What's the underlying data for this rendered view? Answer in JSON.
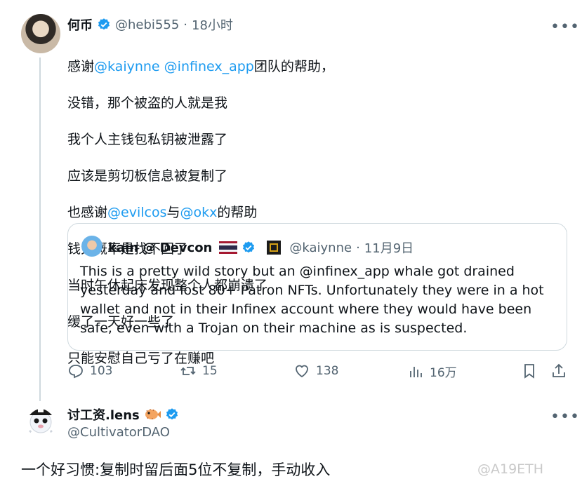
{
  "tweet": {
    "author_name": "何币",
    "handle": "@hebi555",
    "separator": "·",
    "time": "18小时",
    "more_label": "•••",
    "text_line1_prefix": "感谢",
    "text_line1_mention1": "@kaiynne",
    "text_line1_mention2": "@infinex_app",
    "text_line1_suffix": "团队的帮助，",
    "text_line2": "没错，那个被盗的人就是我",
    "text_line3": "我个人主钱包私钥被泄露了",
    "text_line4": "应该是剪切板信息被复制了",
    "text_line5_prefix": "也感谢",
    "text_line5_mention1": "@evilcos",
    "text_line5_mid": "与",
    "text_line5_mention2": "@okx",
    "text_line5_suffix": "的帮助",
    "text_line6": "钱大概率是找不回了",
    "text_line7": "当时午休起床发现整个人都崩溃了",
    "text_line8": "缓了一天好一些了",
    "text_line9": "只能安慰自己亏了在赚吧",
    "quote": {
      "author_name": "kain @ Devcon",
      "handle": "@kaiynne",
      "separator": "·",
      "date": "11月9日",
      "text": "This is a pretty wild story but an @infinex_app whale got drained yesterday and lost 80+ Patron NFTs. Unfortunately they were in a hot wallet and not in their Infinex account where they would have been safe, even with a Trojan on their machine as is suspected."
    },
    "actions": {
      "replies": "103",
      "retweets": "15",
      "likes": "138",
      "views": "16万"
    }
  },
  "reply": {
    "author_name": "讨工资.lens",
    "handle": "@CultivatorDAO",
    "more_label": "•••",
    "text": "一个好习惯:复制时留后面5位不复制，手动收入"
  },
  "watermark": "@A19ETH",
  "colors": {
    "accent": "#1d9bf0",
    "muted": "#536471",
    "border": "#cfd9de"
  }
}
